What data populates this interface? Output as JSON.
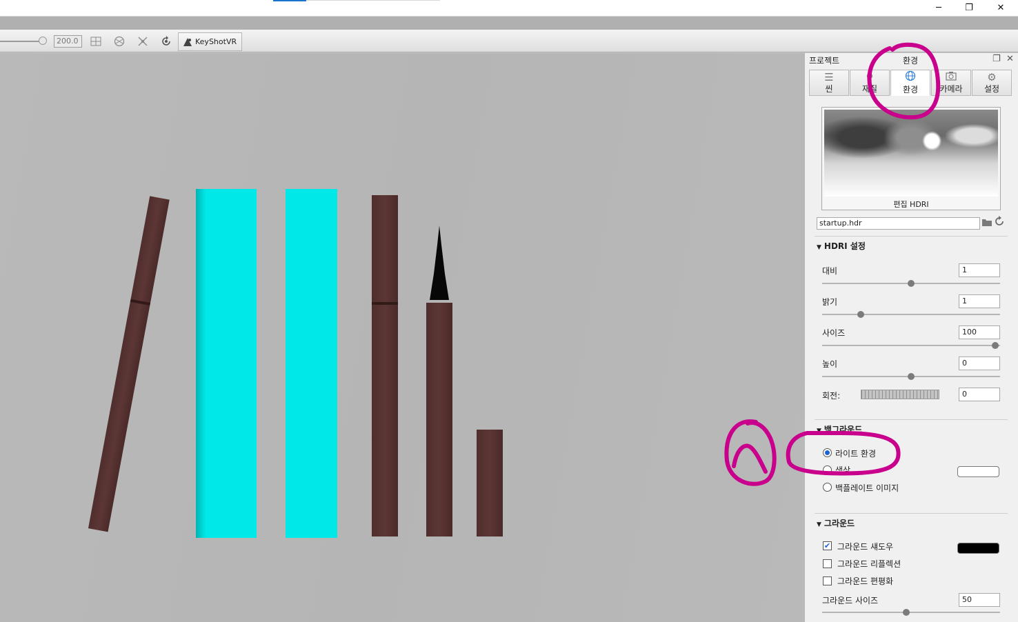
{
  "window": {
    "minimize_icon": "─",
    "restore_icon": "❐",
    "close_icon": "✕"
  },
  "toolbar": {
    "value_field": "200.0",
    "keyshotvr_label": "KeyShotVR"
  },
  "panel": {
    "project_label": "프로젝트",
    "current_title": "환경",
    "tabs": [
      {
        "label": "씬"
      },
      {
        "label": "재질"
      },
      {
        "label": "환경"
      },
      {
        "label": "카메라"
      },
      {
        "label": "설정"
      }
    ],
    "hdri_edit_label": "편집 HDRI",
    "hdri_file": "startup.hdr",
    "hdri_settings": {
      "title": "HDRI 설정",
      "contrast": {
        "label": "대비",
        "value": "1",
        "level": 0.5
      },
      "brightness": {
        "label": "밝기",
        "value": "1",
        "level": 0.21
      },
      "size": {
        "label": "사이즈",
        "value": "100",
        "level": 0.98
      },
      "height": {
        "label": "높이",
        "value": "0",
        "level": 0.5
      },
      "rotation": {
        "label": "회전:",
        "value": "0"
      }
    },
    "background": {
      "title": "백그라운드",
      "options": [
        {
          "label": "라이트 환경",
          "selected": true
        },
        {
          "label": "색상",
          "selected": false
        },
        {
          "label": "백플레이트 이미지",
          "selected": false
        }
      ],
      "color": "#ffffff"
    },
    "ground": {
      "title": "그라운드",
      "shadow": {
        "label": "그라운드 섀도우",
        "checked": true,
        "color": "#000000"
      },
      "reflection": {
        "label": "그라운드 리플렉션",
        "checked": false
      },
      "flatten": {
        "label": "그라운드 편평화",
        "checked": false
      },
      "size": {
        "label": "그라운드 사이즈",
        "value": "50",
        "level": 0.47
      }
    }
  },
  "colors": {
    "annotation": "#c8008c",
    "accent": "#2a7ad6",
    "cyan_object": "#00e8e8",
    "brown_object": "#5a3433"
  }
}
